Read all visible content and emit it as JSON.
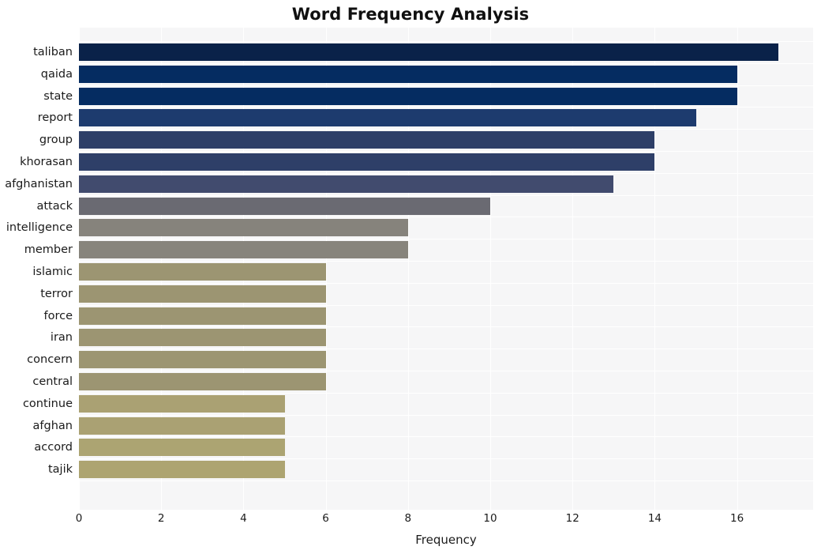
{
  "chart_data": {
    "type": "bar",
    "orientation": "horizontal",
    "title": "Word Frequency Analysis",
    "xlabel": "Frequency",
    "ylabel": "",
    "xlim": [
      0,
      17.85
    ],
    "xticks": [
      0,
      2,
      4,
      6,
      8,
      10,
      12,
      14,
      16
    ],
    "xtick_labels": [
      "0",
      "2",
      "4",
      "6",
      "8",
      "10",
      "12",
      "14",
      "16"
    ],
    "grid": true,
    "legend": null,
    "categories": [
      "taliban",
      "qaida",
      "state",
      "report",
      "group",
      "khorasan",
      "afghanistan",
      "attack",
      "intelligence",
      "member",
      "islamic",
      "terror",
      "force",
      "iran",
      "concern",
      "central",
      "continue",
      "afghan",
      "accord",
      "tajik"
    ],
    "values": [
      17,
      16,
      16,
      15,
      14,
      14,
      13,
      10,
      8,
      8,
      6,
      6,
      6,
      6,
      6,
      6,
      5,
      5,
      5,
      5
    ],
    "bar_colors": [
      "#0a2249",
      "#052c61",
      "#052c61",
      "#1d3b6e",
      "#2e3f68",
      "#2e3f68",
      "#414b6e",
      "#6a6a72",
      "#86837c",
      "#87847c",
      "#9c9572",
      "#9c9572",
      "#9c9572",
      "#9c9572",
      "#9c9572",
      "#9c9572",
      "#aaa173",
      "#aaa173",
      "#aca472",
      "#ada471"
    ],
    "plot_background": "#f6f6f7",
    "grid_color": "#ffffff",
    "figure_background": "#ffffff"
  }
}
